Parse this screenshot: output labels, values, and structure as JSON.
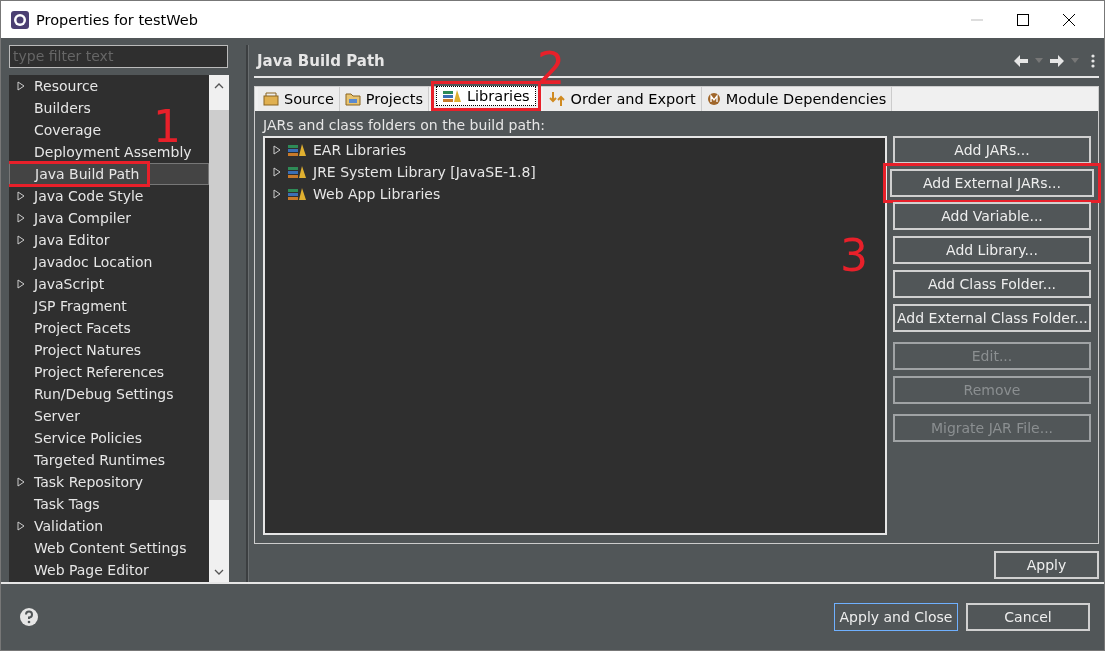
{
  "window": {
    "title": "Properties for testWeb"
  },
  "filter": {
    "placeholder": "type filter text"
  },
  "sidebar": {
    "items": [
      {
        "label": "Resource",
        "expandable": true,
        "selected": false,
        "highlighted": false
      },
      {
        "label": "Builders",
        "expandable": false,
        "selected": false,
        "highlighted": false
      },
      {
        "label": "Coverage",
        "expandable": false,
        "selected": false,
        "highlighted": false
      },
      {
        "label": "Deployment Assembly",
        "expandable": false,
        "selected": false,
        "highlighted": false
      },
      {
        "label": "Java Build Path",
        "expandable": false,
        "selected": true,
        "highlighted": true
      },
      {
        "label": "Java Code Style",
        "expandable": true,
        "selected": false,
        "highlighted": false
      },
      {
        "label": "Java Compiler",
        "expandable": true,
        "selected": false,
        "highlighted": false
      },
      {
        "label": "Java Editor",
        "expandable": true,
        "selected": false,
        "highlighted": false
      },
      {
        "label": "Javadoc Location",
        "expandable": false,
        "selected": false,
        "highlighted": false
      },
      {
        "label": "JavaScript",
        "expandable": true,
        "selected": false,
        "highlighted": false
      },
      {
        "label": "JSP Fragment",
        "expandable": false,
        "selected": false,
        "highlighted": false
      },
      {
        "label": "Project Facets",
        "expandable": false,
        "selected": false,
        "highlighted": false
      },
      {
        "label": "Project Natures",
        "expandable": false,
        "selected": false,
        "highlighted": false
      },
      {
        "label": "Project References",
        "expandable": false,
        "selected": false,
        "highlighted": false
      },
      {
        "label": "Run/Debug Settings",
        "expandable": false,
        "selected": false,
        "highlighted": false
      },
      {
        "label": "Server",
        "expandable": false,
        "selected": false,
        "highlighted": false
      },
      {
        "label": "Service Policies",
        "expandable": false,
        "selected": false,
        "highlighted": false
      },
      {
        "label": "Targeted Runtimes",
        "expandable": false,
        "selected": false,
        "highlighted": false
      },
      {
        "label": "Task Repository",
        "expandable": true,
        "selected": false,
        "highlighted": false
      },
      {
        "label": "Task Tags",
        "expandable": false,
        "selected": false,
        "highlighted": false
      },
      {
        "label": "Validation",
        "expandable": true,
        "selected": false,
        "highlighted": false
      },
      {
        "label": "Web Content Settings",
        "expandable": false,
        "selected": false,
        "highlighted": false
      },
      {
        "label": "Web Page Editor",
        "expandable": false,
        "selected": false,
        "highlighted": false
      }
    ]
  },
  "page": {
    "title": "Java Build Path",
    "tabs": [
      {
        "label": "Source",
        "kind": "source",
        "selected": false,
        "highlighted": false
      },
      {
        "label": "Projects",
        "kind": "projects",
        "selected": false,
        "highlighted": false
      },
      {
        "label": "Libraries",
        "kind": "libraries",
        "selected": true,
        "highlighted": true
      },
      {
        "label": "Order and Export",
        "kind": "order",
        "selected": false,
        "highlighted": false
      },
      {
        "label": "Module Dependencies",
        "kind": "module",
        "selected": false,
        "highlighted": false
      }
    ],
    "list_label": "JARs and class folders on the build path:",
    "libraries": [
      {
        "label": "EAR Libraries",
        "expanded": false
      },
      {
        "label": "JRE System Library [JavaSE-1.8]",
        "expanded": false
      },
      {
        "label": "Web App Libraries",
        "expanded": false
      }
    ],
    "button_groups": [
      [
        {
          "label": "Add JARs...",
          "disabled": false,
          "highlighted": false
        },
        {
          "label": "Add External JARs...",
          "disabled": false,
          "highlighted": true
        },
        {
          "label": "Add Variable...",
          "disabled": false,
          "highlighted": false
        },
        {
          "label": "Add Library...",
          "disabled": false,
          "highlighted": false
        },
        {
          "label": "Add Class Folder...",
          "disabled": false,
          "highlighted": false
        },
        {
          "label": "Add External Class Folder...",
          "disabled": false,
          "highlighted": false
        }
      ],
      [
        {
          "label": "Edit...",
          "disabled": true,
          "highlighted": false
        },
        {
          "label": "Remove",
          "disabled": true,
          "highlighted": false
        }
      ],
      [
        {
          "label": "Migrate JAR File...",
          "disabled": true,
          "highlighted": false
        }
      ]
    ],
    "apply": "Apply"
  },
  "footer": {
    "buttons": [
      {
        "label": "Apply and Close",
        "default": true
      },
      {
        "label": "Cancel",
        "default": false
      }
    ]
  },
  "annotations": [
    {
      "label": "1"
    },
    {
      "label": "2"
    },
    {
      "label": "3"
    }
  ]
}
